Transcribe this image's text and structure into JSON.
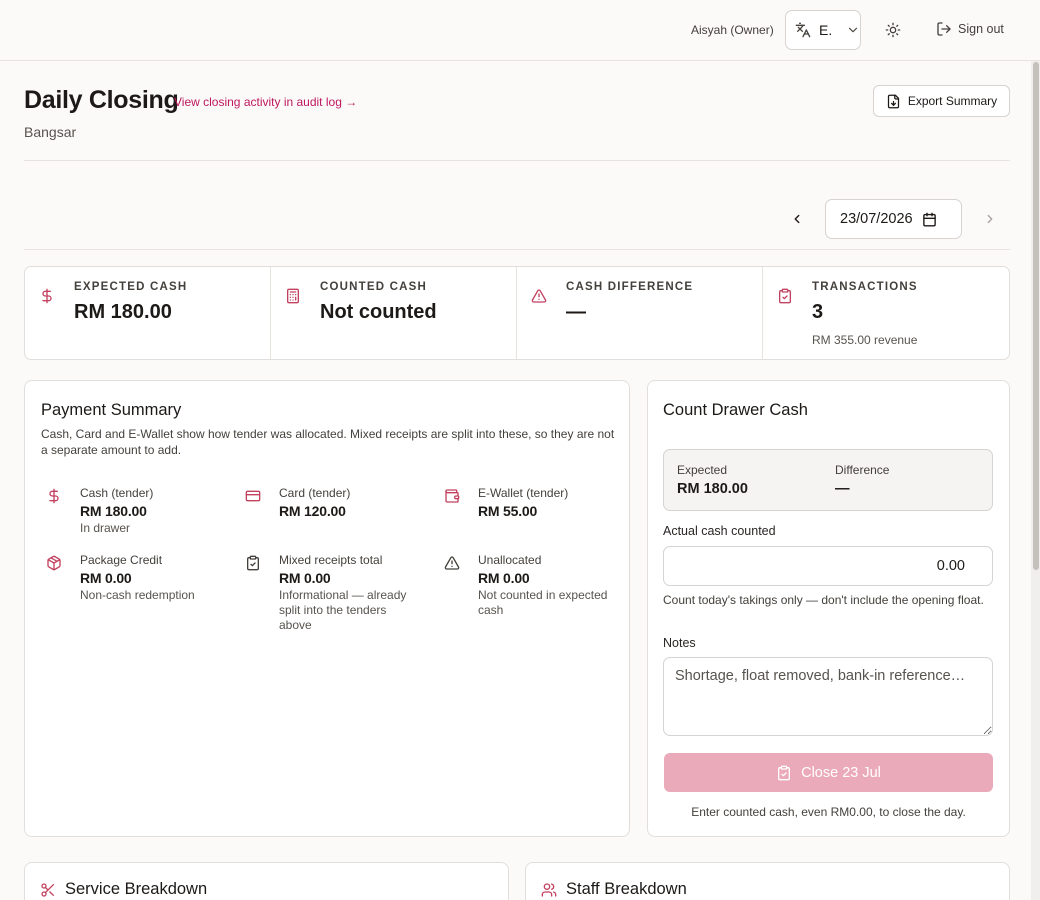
{
  "topbar": {
    "user": "Aisyah (Owner)",
    "language_value": "E.",
    "language_icon": "translate-icon",
    "theme_icon": "sun-icon",
    "signout_label": "Sign out"
  },
  "header": {
    "title": "Daily Closing",
    "audit_link": "View closing activity in audit log →",
    "location": "Bangsar",
    "export_label": "Export Summary"
  },
  "date_nav": {
    "date_value": "23/07/2026"
  },
  "stats": [
    {
      "icon": "dollar-icon",
      "label": "EXPECTED CASH",
      "value": "RM 180.00",
      "sub": ""
    },
    {
      "icon": "calculator-icon",
      "label": "COUNTED CASH",
      "value": "Not counted",
      "sub": ""
    },
    {
      "icon": "warning-icon",
      "label": "CASH DIFFERENCE",
      "value": "—",
      "sub": ""
    },
    {
      "icon": "clipboard-check-icon",
      "label": "TRANSACTIONS",
      "value": "3",
      "sub": "RM 355.00 revenue"
    }
  ],
  "payment_summary": {
    "title": "Payment Summary",
    "description": "Cash, Card and E-Wallet show how tender was allocated. Mixed receipts are split into these, so they are not a separate amount to add.",
    "items": [
      {
        "icon": "dollar-icon",
        "label": "Cash (tender)",
        "value": "RM 180.00",
        "sub": "In drawer"
      },
      {
        "icon": "card-icon",
        "label": "Card (tender)",
        "value": "RM 120.00",
        "sub": ""
      },
      {
        "icon": "wallet-icon",
        "label": "E-Wallet (tender)",
        "value": "RM 55.00",
        "sub": ""
      },
      {
        "icon": "package-icon",
        "label": "Package Credit",
        "value": "RM 0.00",
        "sub": "Non-cash redemption"
      },
      {
        "icon": "clipboard-check-icon",
        "label": "Mixed receipts total",
        "value": "RM 0.00",
        "sub": "Informational — already split into the tenders above"
      },
      {
        "icon": "warning-icon",
        "label": "Unallocated",
        "value": "RM 0.00",
        "sub": "Not counted in expected cash"
      }
    ]
  },
  "count_drawer": {
    "title": "Count Drawer Cash",
    "expected_label": "Expected",
    "expected_value": "RM 180.00",
    "difference_label": "Difference",
    "difference_value": "—",
    "actual_label": "Actual cash counted",
    "actual_value": "0.00",
    "actual_hint": "Count today's takings only — don't include the opening float.",
    "notes_label": "Notes",
    "notes_placeholder": "Shortage, float removed, bank-in reference…",
    "close_label": "Close 23 Jul",
    "close_note": "Enter counted cash, even RM0.00, to close the day."
  },
  "bottom": {
    "service_title": "Service Breakdown",
    "staff_title": "Staff Breakdown"
  },
  "colors": {
    "accent": "#be185d",
    "button_disabled": "#ebaab9",
    "icon_accent": "#c2415f"
  }
}
